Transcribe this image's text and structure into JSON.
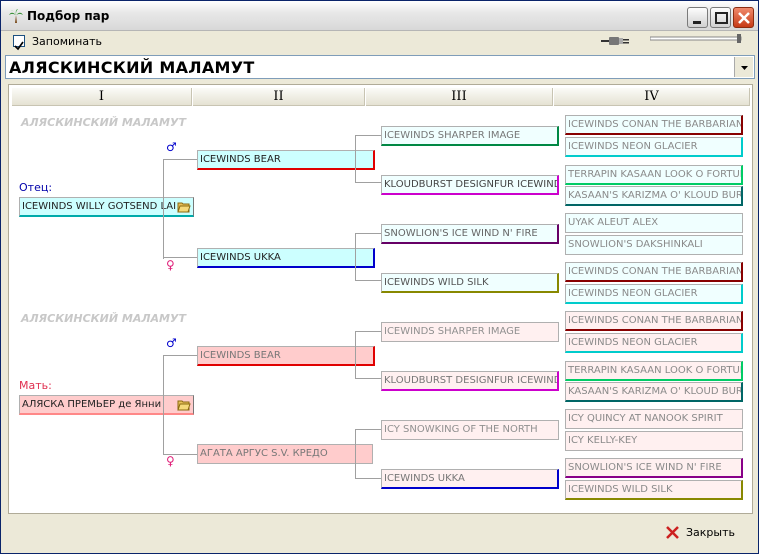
{
  "window": {
    "title": "Подбор пар"
  },
  "toolbar": {
    "remember_label": "Запоминать",
    "remember_checked": true
  },
  "breed": {
    "selected": "АЛЯСКИНСКИЙ МАЛАМУТ"
  },
  "generations": [
    "I",
    "II",
    "III",
    "IV"
  ],
  "father": {
    "label": "Отец:",
    "name": "ICEWINDS WILLY GOTSEND LAI",
    "watermark": "АЛЯСКИНСКИЙ МАЛАМУТ",
    "sire": "ICEWINDS BEAR",
    "dam": "ICEWINDS UKKA",
    "sire_sire": "ICEWINDS SHARPER IMAGE",
    "sire_dam": "KLOUDBURST DESIGNFUR ICEWIND",
    "dam_sire": "SNOWLION'S ICE WIND N' FIRE",
    "dam_dam": "ICEWINDS WILD SILK",
    "gen4": [
      "ICEWINDS CONAN THE BARBARIAN",
      "ICEWINDS NEON GLACIER",
      "TERRAPIN KASAAN LOOK O FORTUNE",
      "KASAAN'S KARIZMA O' KLOUD BURST",
      "UYAK ALEUT ALEX",
      "SNOWLION'S DAKSHINKALI",
      "ICEWINDS CONAN THE BARBARIAN",
      "ICEWINDS NEON GLACIER"
    ]
  },
  "mother": {
    "label": "Мать:",
    "name": "АЛЯСКА ПРЕМЬЕР де Янни",
    "watermark": "АЛЯСКИНСКИЙ МАЛАМУТ",
    "sire": "ICEWINDS BEAR",
    "dam": "АГАТА АРГУС S.V. КРЕДО",
    "sire_sire": "ICEWINDS SHARPER IMAGE",
    "sire_dam": "KLOUDBURST DESIGNFUR ICEWIND",
    "dam_sire": "ICY SNOWKING OF THE NORTH",
    "dam_dam": "ICEWINDS UKKA",
    "gen4": [
      "ICEWINDS CONAN THE BARBARIAN",
      "ICEWINDS NEON GLACIER",
      "TERRAPIN KASAAN LOOK O FORTUNE",
      "KASAAN'S KARIZMA O' KLOUD BURST",
      "ICY QUINCY AT NANOOK SPIRIT",
      "ICY KELLY-KEY",
      "SNOWLION'S ICE WIND N' FIRE",
      "ICEWINDS WILD SILK"
    ]
  },
  "symbols": {
    "male": "♂",
    "female": "♀"
  },
  "footer": {
    "close_label": "Закрыть"
  },
  "colors": {
    "sire_accent": "#e00000",
    "dam_accent": "#0000cc",
    "male_symbol": "#0000cc",
    "female_symbol": "#e0207a"
  }
}
